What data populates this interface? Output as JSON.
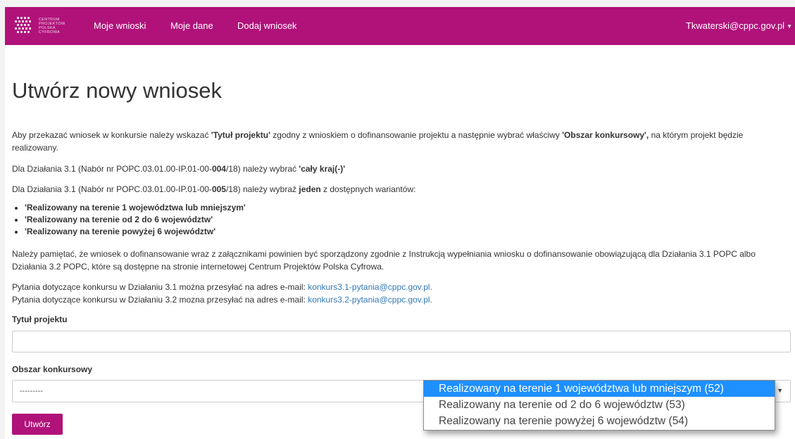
{
  "colors": {
    "brand": "#b0127a",
    "link": "#337ab7",
    "selected": "#1e90ff"
  },
  "header": {
    "logo_lines": [
      "Centrum",
      "Projektów",
      "Polska",
      "Cyfrowa"
    ],
    "nav": [
      {
        "label": "Moje wnioski"
      },
      {
        "label": "Moje dane"
      },
      {
        "label": "Dodaj wniosek"
      }
    ],
    "user": "Tkwaterski@cppc.gov.pl"
  },
  "main": {
    "title": "Utwórz nowy wniosek",
    "intro": {
      "p1a": "Aby przekazać wniosek w konkursie należy wskazać ",
      "p1b": "'Tytuł projektu'",
      "p1c": " zgodny z wnioskiem o dofinansowanie projektu a następnie wybrać właściwy ",
      "p1d": "'Obszar konkursowy',",
      "p1e": " na którym projekt będzie realizowany."
    },
    "rule1": {
      "a": "Dla Działania 3.1 (Nabór nr POPC.03.01.00-IP.01-00-",
      "b": "004",
      "c": "/18) należy wybrać ",
      "d": "'cały kraj(-)'"
    },
    "rule2": {
      "a": "Dla Działania 3.1 (Nabór nr POPC.03.01.00-IP.01-00-",
      "b": "005",
      "c": "/18) należy wybraź ",
      "d": "jeden",
      "e": " z dostępnych wariantów:"
    },
    "variants": [
      "'Realizowany na terenie 1 województwa lub mniejszym'",
      "'Realizowany na terenie od 2 do 6 województw'",
      "'Realizowany na terenie powyżej 6 województw'"
    ],
    "note": "Należy pamiętać, że wniosek o dofinansowanie wraz z załącznikami powinien być sporządzony zgodnie z Instrukcją wypełniania wniosku o dofinansowanie obowiązującą dla Działania 3.1 POPC albo Działania 3.2 POPC, które są dostępne na stronie internetowej Centrum Projektów Polska Cyfrowa.",
    "contact1": {
      "text": "Pytania dotyczące konkursu w Działaniu 3.1 można przesyłać na adres e-mail: ",
      "email": "konkurs3.1-pytania@cppc.gov.pl."
    },
    "contact2": {
      "text": "Pytania dotyczące konkursu w Działaniu 3.2 mozna przesyłać na adres e-mail: ",
      "email": "konkurs3.2-pytania@cppc.gov.pl."
    }
  },
  "form": {
    "title_label": "Tytuł projektu",
    "title_value": "",
    "area_label": "Obszar konkursowy",
    "area_selected": "---------",
    "area_options": [
      "Realizowany na terenie 1 województwa lub mniejszym (52)",
      "Realizowany na terenie od 2 do 6 województw (53)",
      "Realizowany na terenie powyżej 6 województw (54)"
    ],
    "submit_label": "Utwórz"
  }
}
